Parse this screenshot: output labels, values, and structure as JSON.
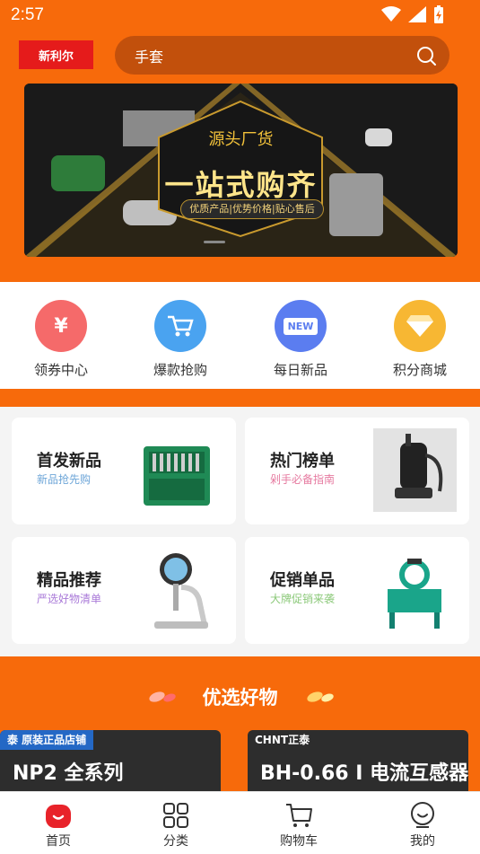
{
  "status": {
    "time": "2:57"
  },
  "header": {
    "logo_text": "新利尔",
    "search_text": "手套"
  },
  "banner": {
    "subtitle": "源头厂货",
    "headline": "一站式购齐",
    "tagline": "优质产品|优势价格|贴心售后"
  },
  "quick": [
    {
      "label": "领券中心",
      "glyph": "¥",
      "color": "#f56a6a"
    },
    {
      "label": "爆款抢购",
      "glyph": "",
      "color": "#4aa3f0"
    },
    {
      "label": "每日新品",
      "glyph": "NEW",
      "color": "#5b7df0"
    },
    {
      "label": "积分商城",
      "glyph": "",
      "color": "#f7b733"
    }
  ],
  "cards": [
    {
      "title": "首发新品",
      "subtitle": "新品抢先购",
      "sub_color": "#6ea6d8"
    },
    {
      "title": "热门榜单",
      "subtitle": "剁手必备指南",
      "sub_color": "#e67aa0"
    },
    {
      "title": "精品推荐",
      "subtitle": "严选好物清单",
      "sub_color": "#a979d8"
    },
    {
      "title": "促销单品",
      "subtitle": "大牌促销来袭",
      "sub_color": "#8cc97a"
    }
  ],
  "featured": {
    "title": "优选好物",
    "products": [
      {
        "tag": "泰 原装正品店铺",
        "text": "NP2 全系列"
      },
      {
        "tag": "CHNT正泰",
        "text": "BH-0.66 I 电流互感器"
      }
    ]
  },
  "nav": [
    {
      "label": "首页",
      "icon": "home-icon"
    },
    {
      "label": "分类",
      "icon": "grid-icon"
    },
    {
      "label": "购物车",
      "icon": "cart-icon"
    },
    {
      "label": "我的",
      "icon": "user-icon"
    }
  ]
}
